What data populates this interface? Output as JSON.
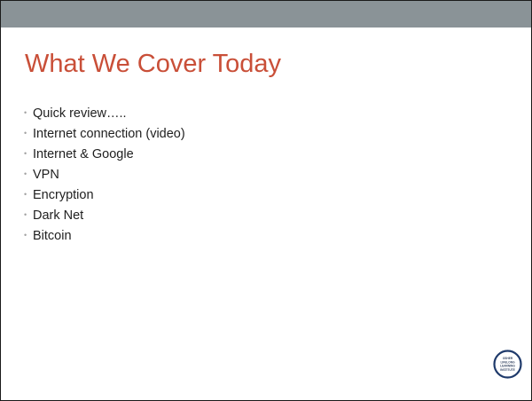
{
  "slide": {
    "title": "What We Cover Today",
    "bullet_glyph": "•",
    "bullets": [
      {
        "label": "Quick review….."
      },
      {
        "label": "Internet connection (video)"
      },
      {
        "label": "Internet & Google"
      },
      {
        "label": "VPN"
      },
      {
        "label": "Encryption"
      },
      {
        "label": "Dark Net"
      },
      {
        "label": "Bitcoin"
      }
    ]
  },
  "logo": {
    "icon": "osher-lifelong-learning-institute-seal",
    "lines": [
      "OSHER",
      "LIFELONG",
      "LEARNING",
      "INSTITUTE"
    ]
  },
  "colors": {
    "top_band": "#8a9397",
    "title": "#c94f38",
    "text": "#1f1f1f",
    "bullet": "#a2a2a2",
    "logo_ring": "#1f3a6b"
  }
}
